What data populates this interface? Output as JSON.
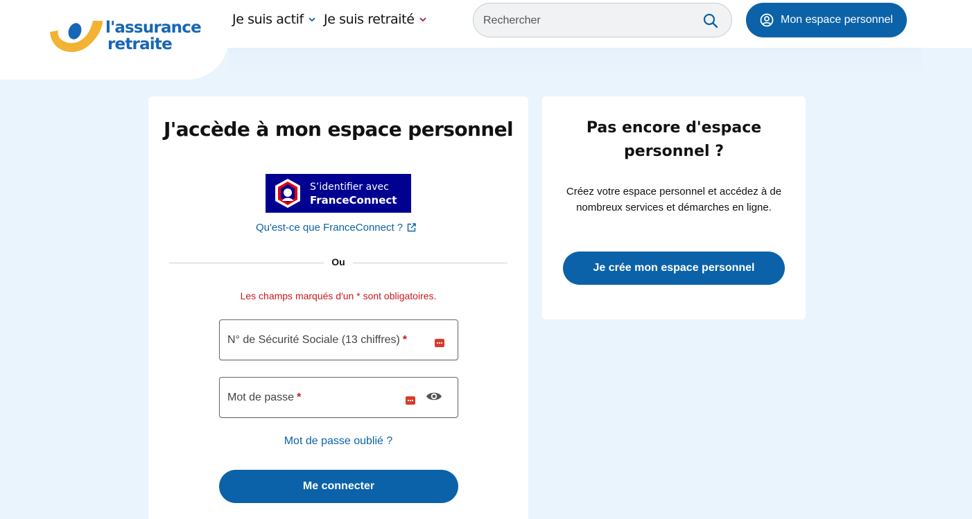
{
  "brand": {
    "logo_line1": "l'assurance",
    "logo_line2": "retraite",
    "primary_color": "#0b62a8",
    "logo_yellow": "#f2b233"
  },
  "nav": {
    "items": [
      {
        "label": "Je suis actif",
        "chevron_color": "#0b62a8"
      },
      {
        "label": "Je suis retraité",
        "chevron_color": "#a3185a"
      }
    ]
  },
  "search": {
    "placeholder": "Rechercher",
    "icon": "search-icon"
  },
  "account_button": {
    "label": "Mon espace personnel",
    "icon": "user-circle-icon"
  },
  "login": {
    "title": "J'accède à mon espace personnel",
    "franceconnect": {
      "line1": "S’identifier avec",
      "line2": "FranceConnect",
      "background": "#000091",
      "info_link": "Qu'est-ce que FranceConnect ?",
      "info_icon": "external-link-icon"
    },
    "separator": "Ou",
    "required_note": "Les champs marqués d'un * sont obligatoires.",
    "fields": {
      "ssn_label": "N° de Sécurité Sociale (13 chiffres)",
      "password_label": "Mot de passe",
      "required_mark": "*"
    },
    "forgot_password": "Mot de passe oublié ?",
    "submit": "Me connecter"
  },
  "signup": {
    "title": "Pas encore d'espace personnel ?",
    "description": "Créez votre espace personnel et accédez à de nombreux services et démarches en ligne.",
    "button": "Je crée mon espace personnel"
  }
}
